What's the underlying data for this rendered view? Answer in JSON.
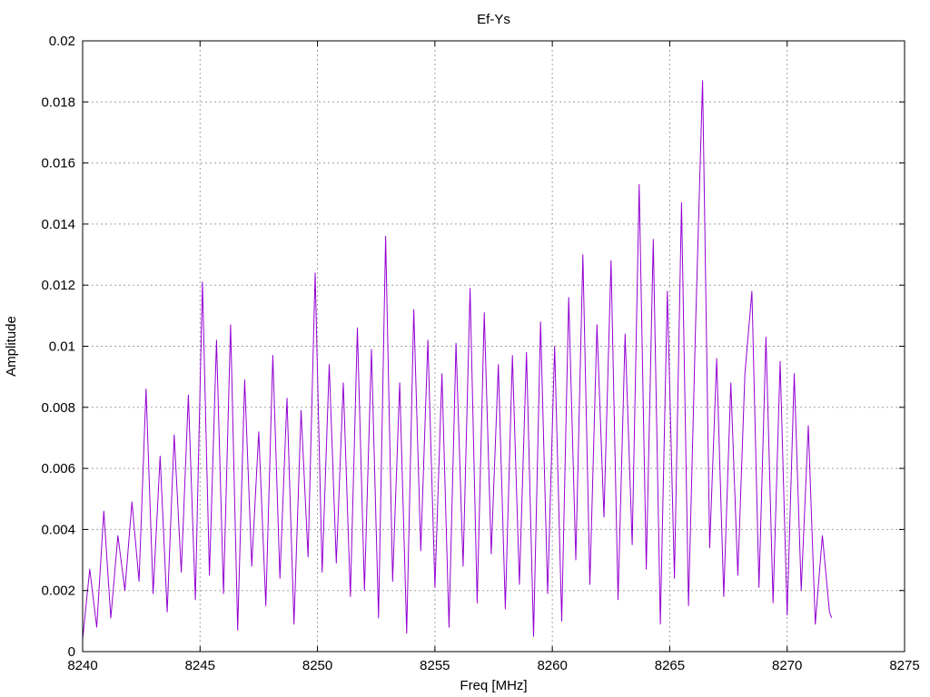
{
  "chart_data": {
    "type": "line",
    "title": "Ef-Ys",
    "xlabel": "Freq [MHz]",
    "ylabel": "Amplitude",
    "xlim": [
      8240,
      8275
    ],
    "ylim": [
      0,
      0.02
    ],
    "x_ticks": [
      8240,
      8245,
      8250,
      8255,
      8260,
      8265,
      8270,
      8275
    ],
    "y_ticks": [
      0,
      0.002,
      0.004,
      0.006,
      0.008,
      0.01,
      0.012,
      0.014,
      0.016,
      0.018,
      0.02
    ],
    "x_tick_labels": [
      "8240",
      "8245",
      "8250",
      "8255",
      "8260",
      "8265",
      "8270",
      "8275"
    ],
    "y_tick_labels": [
      "0",
      "0.002",
      "0.004",
      "0.006",
      "0.008",
      "0.01",
      "0.012",
      "0.014",
      "0.016",
      "0.018",
      "0.02"
    ],
    "grid": true,
    "legend": "none",
    "line_color": "#9400d3",
    "series": [
      {
        "x": [
          8240.0,
          8240.3,
          8240.6,
          8240.9,
          8241.2,
          8241.5,
          8241.8,
          8242.1,
          8242.4,
          8242.7,
          8243.0,
          8243.3,
          8243.6,
          8243.9,
          8244.2,
          8244.5,
          8244.8,
          8245.1,
          8245.4,
          8245.7,
          8246.0,
          8246.3,
          8246.6,
          8246.9,
          8247.2,
          8247.5,
          8247.8,
          8248.1,
          8248.4,
          8248.7,
          8249.0,
          8249.3,
          8249.6,
          8249.9,
          8250.2,
          8250.5,
          8250.8,
          8251.1,
          8251.4,
          8251.7,
          8252.0,
          8252.3,
          8252.6,
          8252.9,
          8253.2,
          8253.5,
          8253.8,
          8254.1,
          8254.4,
          8254.7,
          8255.0,
          8255.3,
          8255.6,
          8255.9,
          8256.2,
          8256.5,
          8256.8,
          8257.1,
          8257.4,
          8257.7,
          8258.0,
          8258.3,
          8258.6,
          8258.9,
          8259.2,
          8259.5,
          8259.8,
          8260.1,
          8260.4,
          8260.7,
          8261.0,
          8261.3,
          8261.6,
          8261.9,
          8262.2,
          8262.5,
          8262.8,
          8263.1,
          8263.4,
          8263.7,
          8264.0,
          8264.3,
          8264.6,
          8264.9,
          8265.2,
          8265.5,
          8265.8,
          8266.1,
          8266.4,
          8266.7,
          8267.0,
          8267.3,
          8267.6,
          8267.9,
          8268.2,
          8268.5,
          8268.8,
          8269.1,
          8269.4,
          8269.7,
          8270.0,
          8270.3,
          8270.6,
          8270.9,
          8271.2,
          8271.5,
          8271.8,
          8271.9
        ],
        "values": [
          0.0004,
          0.0027,
          0.0008,
          0.0046,
          0.0011,
          0.0038,
          0.002,
          0.0049,
          0.0023,
          0.0086,
          0.0019,
          0.0064,
          0.0013,
          0.0071,
          0.0026,
          0.0084,
          0.0017,
          0.0121,
          0.0025,
          0.0102,
          0.0019,
          0.0107,
          0.0007,
          0.0089,
          0.0028,
          0.0072,
          0.0015,
          0.0097,
          0.0024,
          0.0083,
          0.0009,
          0.0079,
          0.0031,
          0.0124,
          0.0026,
          0.0094,
          0.0029,
          0.0088,
          0.0018,
          0.0106,
          0.002,
          0.0099,
          0.0011,
          0.0136,
          0.0023,
          0.0088,
          0.0006,
          0.0112,
          0.0033,
          0.0102,
          0.0021,
          0.0091,
          0.0008,
          0.0101,
          0.0028,
          0.0119,
          0.0016,
          0.0111,
          0.0032,
          0.0094,
          0.0014,
          0.0097,
          0.0022,
          0.0098,
          0.0005,
          0.0108,
          0.0019,
          0.01,
          0.001,
          0.0116,
          0.003,
          0.013,
          0.0022,
          0.0107,
          0.0044,
          0.0128,
          0.0017,
          0.0104,
          0.0035,
          0.0153,
          0.0027,
          0.0135,
          0.0009,
          0.0118,
          0.0024,
          0.0147,
          0.0015,
          0.0107,
          0.0187,
          0.0034,
          0.0096,
          0.0018,
          0.0088,
          0.0025,
          0.0091,
          0.0118,
          0.0021,
          0.0103,
          0.0016,
          0.0095,
          0.0012,
          0.0091,
          0.002,
          0.0074,
          0.0009,
          0.0038,
          0.0013,
          0.0011
        ]
      }
    ]
  }
}
